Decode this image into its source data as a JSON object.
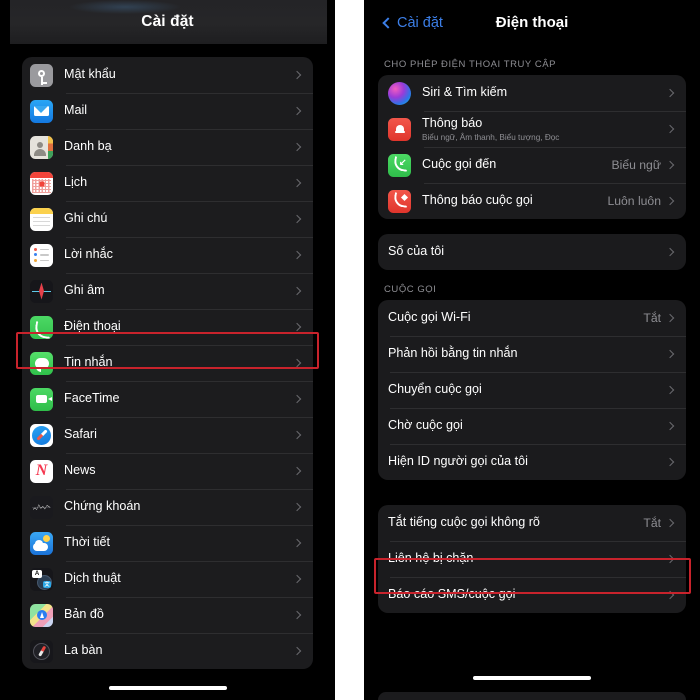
{
  "left_panel": {
    "header": {
      "title": "Cài đặt"
    },
    "items": [
      {
        "label": "Mật khẩu",
        "icon": "key-icon",
        "icon_class": "ic-key"
      },
      {
        "label": "Mail",
        "icon": "mail-icon",
        "icon_class": "ic-mail"
      },
      {
        "label": "Danh bạ",
        "icon": "contacts-icon",
        "icon_class": "ic-contacts"
      },
      {
        "label": "Lịch",
        "icon": "calendar-icon",
        "icon_class": "ic-cal"
      },
      {
        "label": "Ghi chú",
        "icon": "notes-icon",
        "icon_class": "ic-notes"
      },
      {
        "label": "Lời nhắc",
        "icon": "reminders-icon",
        "icon_class": "ic-reminders"
      },
      {
        "label": "Ghi âm",
        "icon": "voice-memos-icon",
        "icon_class": "ic-voice"
      },
      {
        "label": "Điện thoại",
        "icon": "phone-icon",
        "icon_class": "ic-phone"
      },
      {
        "label": "Tin nhắn",
        "icon": "messages-icon",
        "icon_class": "ic-msg"
      },
      {
        "label": "FaceTime",
        "icon": "facetime-icon",
        "icon_class": "ic-ft"
      },
      {
        "label": "Safari",
        "icon": "safari-icon",
        "icon_class": "ic-safari"
      },
      {
        "label": "News",
        "icon": "news-icon",
        "icon_class": "ic-news"
      },
      {
        "label": "Chứng khoán",
        "icon": "stocks-icon",
        "icon_class": "ic-stocks"
      },
      {
        "label": "Thời tiết",
        "icon": "weather-icon",
        "icon_class": "ic-weather"
      },
      {
        "label": "Dịch thuật",
        "icon": "translate-icon",
        "icon_class": "ic-translate"
      },
      {
        "label": "Bản đồ",
        "icon": "maps-icon",
        "icon_class": "ic-maps"
      },
      {
        "label": "La bàn",
        "icon": "compass-icon",
        "icon_class": "ic-compass"
      }
    ],
    "highlighted_item": "Điện thoại"
  },
  "right_panel": {
    "header": {
      "back_label": "Cài đặt",
      "title": "Điện thoại"
    },
    "section1": {
      "label": "CHO PHÉP ĐIỆN THOẠI TRUY CẬP",
      "items": [
        {
          "label": "Siri & Tìm kiếm",
          "sublabel": "",
          "value": "",
          "icon": "siri-icon",
          "icon_class": "ic-siri"
        },
        {
          "label": "Thông báo",
          "sublabel": "Biểu ngữ, Âm thanh, Biểu tượng, Đọc",
          "value": "",
          "icon": "notifications-bell-icon",
          "icon_class": "ic-bell"
        },
        {
          "label": "Cuộc gọi đến",
          "sublabel": "",
          "value": "Biểu ngữ",
          "icon": "incoming-call-icon",
          "icon_class": "ic-callin"
        },
        {
          "label": "Thông báo cuộc gọi",
          "sublabel": "",
          "value": "Luôn luôn",
          "icon": "call-notification-icon",
          "icon_class": "ic-callnotif"
        }
      ]
    },
    "section2": {
      "label": "",
      "items": [
        {
          "label": "Số của tôi",
          "value": ""
        }
      ]
    },
    "section3": {
      "label": "CUỘC GỌI",
      "items": [
        {
          "label": "Cuộc gọi Wi-Fi",
          "value": "Tắt"
        },
        {
          "label": "Phản hồi bằng tin nhắn",
          "value": ""
        },
        {
          "label": "Chuyển cuộc gọi",
          "value": ""
        },
        {
          "label": "Chờ cuộc gọi",
          "value": ""
        },
        {
          "label": "Hiện ID người gọi của tôi",
          "value": ""
        }
      ]
    },
    "section4": {
      "label": "",
      "items": [
        {
          "label": "Tắt tiếng cuộc gọi không rõ",
          "value": "Tắt"
        },
        {
          "label": "Liên hệ bị chặn",
          "value": ""
        },
        {
          "label": "Báo cáo SMS/cuộc gọi",
          "value": ""
        }
      ]
    },
    "highlighted_item": "Tắt tiếng cuộc gọi không rõ"
  },
  "colors": {
    "accent_blue": "#3c7fe8",
    "highlight_red": "#c8232c",
    "card_bg": "#1c1c1e",
    "page_bg": "#000000",
    "secondary_text": "#8e8e93"
  }
}
